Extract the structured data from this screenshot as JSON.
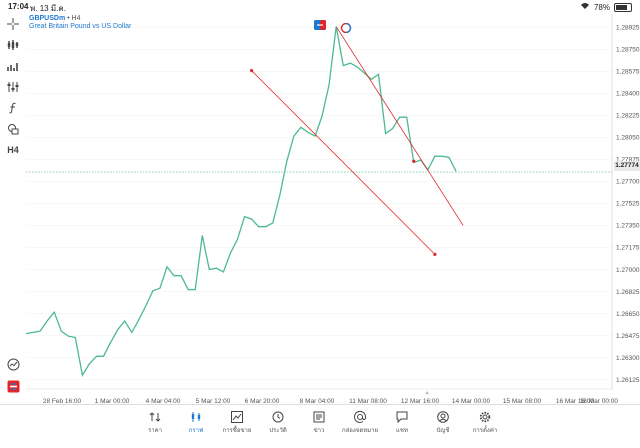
{
  "statusbar": {
    "time": "17:04",
    "date": "พ. 13 มี.ค.",
    "battery": "78%",
    "battery_level": 0.78
  },
  "symbol": {
    "name": "GBPUSDm",
    "timeframe": "H4",
    "description": "Great Britain Pound vs US Dollar"
  },
  "toolbar": {
    "timeframe_label": "H4"
  },
  "current_price": "1.27774",
  "colors": {
    "line": "#4cba8e",
    "channel": "#e0282c",
    "accent": "#1e78d2",
    "price_line": "#4cba8e"
  },
  "chart_data": {
    "type": "line",
    "y_ticks": [
      "1.28925",
      "1.28750",
      "1.28575",
      "1.28400",
      "1.28225",
      "1.28050",
      "1.27875",
      "1.27700",
      "1.27525",
      "1.27350",
      "1.27175",
      "1.27000",
      "1.26825",
      "1.26650",
      "1.26475",
      "1.26300",
      "1.26125"
    ],
    "ylim": [
      1.2605,
      1.2903
    ],
    "x_ticks": [
      "28 Feb 16:00",
      "1 Mar 00:00",
      "4 Mar 04:00",
      "5 Mar 12:00",
      "6 Mar 20:00",
      "8 Mar 04:00",
      "11 Mar 08:00",
      "12 Mar 16:00",
      "14 Mar 00:00",
      "15 Mar 08:00",
      "16 Mar 16:00",
      "18 Mar 00:00"
    ],
    "values": [
      1.2649,
      1.265,
      1.2651,
      1.2659,
      1.2666,
      1.2651,
      1.2647,
      1.2646,
      1.2616,
      1.2625,
      1.2631,
      1.2631,
      1.2642,
      1.2652,
      1.2659,
      1.265,
      1.266,
      1.2671,
      1.2683,
      1.2685,
      1.2702,
      1.2695,
      1.2695,
      1.2684,
      1.2684,
      1.2727,
      1.27,
      1.2701,
      1.2698,
      1.2713,
      1.2724,
      1.2742,
      1.274,
      1.2734,
      1.2734,
      1.2737,
      1.2759,
      1.2786,
      1.2806,
      1.2813,
      1.2809,
      1.2806,
      1.2822,
      1.2847,
      1.2893,
      1.2862,
      1.2864,
      1.2861,
      1.2856,
      1.2851,
      1.2855,
      1.2808,
      1.2812,
      1.2821,
      1.2821,
      1.2785,
      1.2787,
      1.2779,
      1.279,
      1.279,
      1.2789,
      1.2778
    ],
    "current": 1.27774,
    "channel": {
      "upper": [
        [
          44,
          1.2893
        ],
        [
          62,
          1.2735
        ]
      ],
      "lower": [
        [
          32,
          1.2858
        ],
        [
          55,
          1.2786
        ],
        [
          58,
          1.2712
        ]
      ]
    }
  },
  "nav": [
    {
      "label": "ราคา",
      "icon": "quotes-icon"
    },
    {
      "label": "กราฟ",
      "icon": "chart-icon"
    },
    {
      "label": "การซื้อขาย",
      "icon": "trade-icon"
    },
    {
      "label": "ประวัติ",
      "icon": "history-icon"
    },
    {
      "label": "ข่าว",
      "icon": "news-icon"
    },
    {
      "label": "กล่องจดหมาย",
      "icon": "mailbox-icon"
    },
    {
      "label": "แชท",
      "icon": "chat-icon"
    },
    {
      "label": "บัญชี",
      "icon": "account-icon"
    },
    {
      "label": "การตั้งค่า",
      "icon": "settings-icon"
    }
  ]
}
